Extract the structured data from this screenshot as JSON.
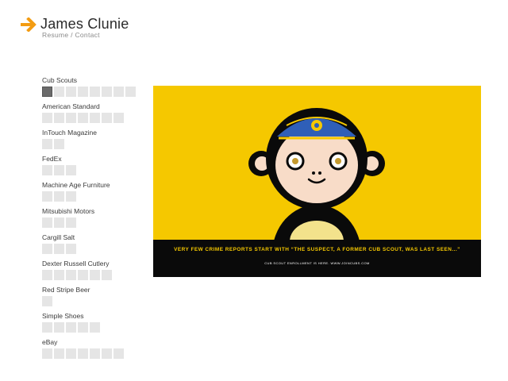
{
  "header": {
    "title": "James Clunie",
    "nav": {
      "resume": "Resume",
      "separator": " / ",
      "contact": "Contact"
    },
    "arrow_icon": "arrow-right-icon",
    "accent_color": "#f39c12"
  },
  "clients": [
    {
      "name": "Cub Scouts",
      "pieces": 8,
      "active_index": 0
    },
    {
      "name": "American Standard",
      "pieces": 7
    },
    {
      "name": "InTouch Magazine",
      "pieces": 2
    },
    {
      "name": "FedEx",
      "pieces": 3
    },
    {
      "name": "Machine Age Furniture",
      "pieces": 3
    },
    {
      "name": "Mitsubishi Motors",
      "pieces": 3
    },
    {
      "name": "Cargill Salt",
      "pieces": 3
    },
    {
      "name": "Dexter Russell Cutlery",
      "pieces": 6
    },
    {
      "name": "Red Stripe Beer",
      "pieces": 1
    },
    {
      "name": "Simple Shoes",
      "pieces": 5
    },
    {
      "name": "eBay",
      "pieces": 7
    }
  ],
  "artwork": {
    "headline": "VERY FEW CRIME REPORTS START WITH “THE SUSPECT, A FORMER CUB SCOUT, WAS LAST SEEN...”",
    "subline": "CUB SCOUT ENROLLMENT IS HERE. WWW.JOINCUBS.COM",
    "fineprint": "",
    "colors": {
      "background": "#f5c800",
      "band": "#0a0a0a",
      "cap": "#2f5fb8",
      "face": "#f8dcc8",
      "shirt": "#f3e28c"
    }
  }
}
